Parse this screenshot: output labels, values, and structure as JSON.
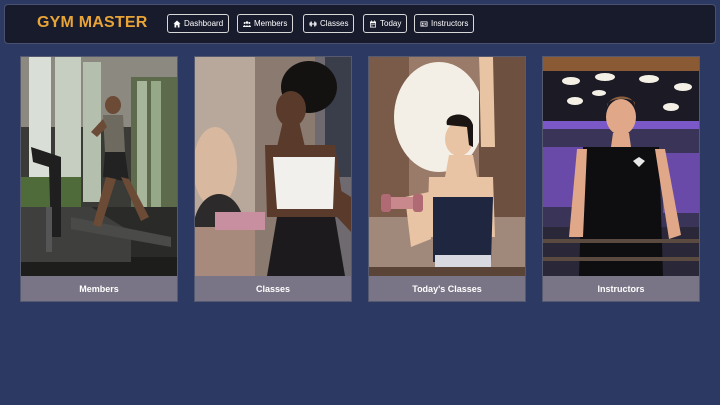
{
  "app": {
    "brand": "GYM MASTER"
  },
  "nav": {
    "items": [
      {
        "label": "Dashboard",
        "icon": "home-icon"
      },
      {
        "label": "Members",
        "icon": "users-icon"
      },
      {
        "label": "Classes",
        "icon": "dumbbell-icon"
      },
      {
        "label": "Today",
        "icon": "calendar-icon"
      },
      {
        "label": "Instructors",
        "icon": "id-card-icon"
      }
    ]
  },
  "cards": [
    {
      "title": "Members",
      "image": "treadmill-runner-photo"
    },
    {
      "title": "Classes",
      "image": "fitness-class-woman-photo"
    },
    {
      "title": "Today's Classes",
      "image": "dumbbell-workout-photo"
    },
    {
      "title": "Instructors",
      "image": "instructor-boxing-ring-photo"
    }
  ],
  "colors": {
    "background": "#2c3a63",
    "navbar": "#181b2c",
    "brand": "#e8a437",
    "caption_bar": "#7a7586"
  }
}
